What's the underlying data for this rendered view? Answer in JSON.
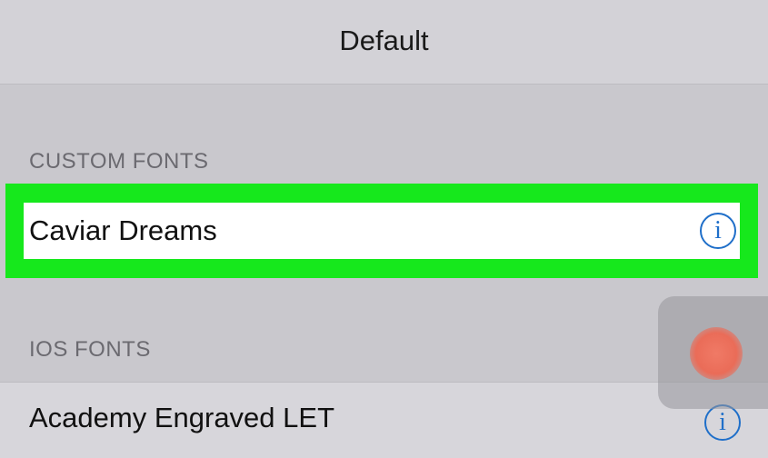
{
  "default_row": {
    "label": "Default"
  },
  "sections": {
    "custom_fonts": {
      "header": "CUSTOM FONTS",
      "items": [
        {
          "name": "Caviar Dreams",
          "info_icon": "info-icon"
        }
      ]
    },
    "ios_fonts": {
      "header": "IOS FONTS",
      "items": [
        {
          "name": "Academy Engraved LET",
          "info_icon": "info-icon"
        }
      ]
    }
  },
  "colors": {
    "highlight": "#16e81c",
    "info_blue": "#1f6fc9",
    "touch_indicator": "#ea6c58"
  }
}
